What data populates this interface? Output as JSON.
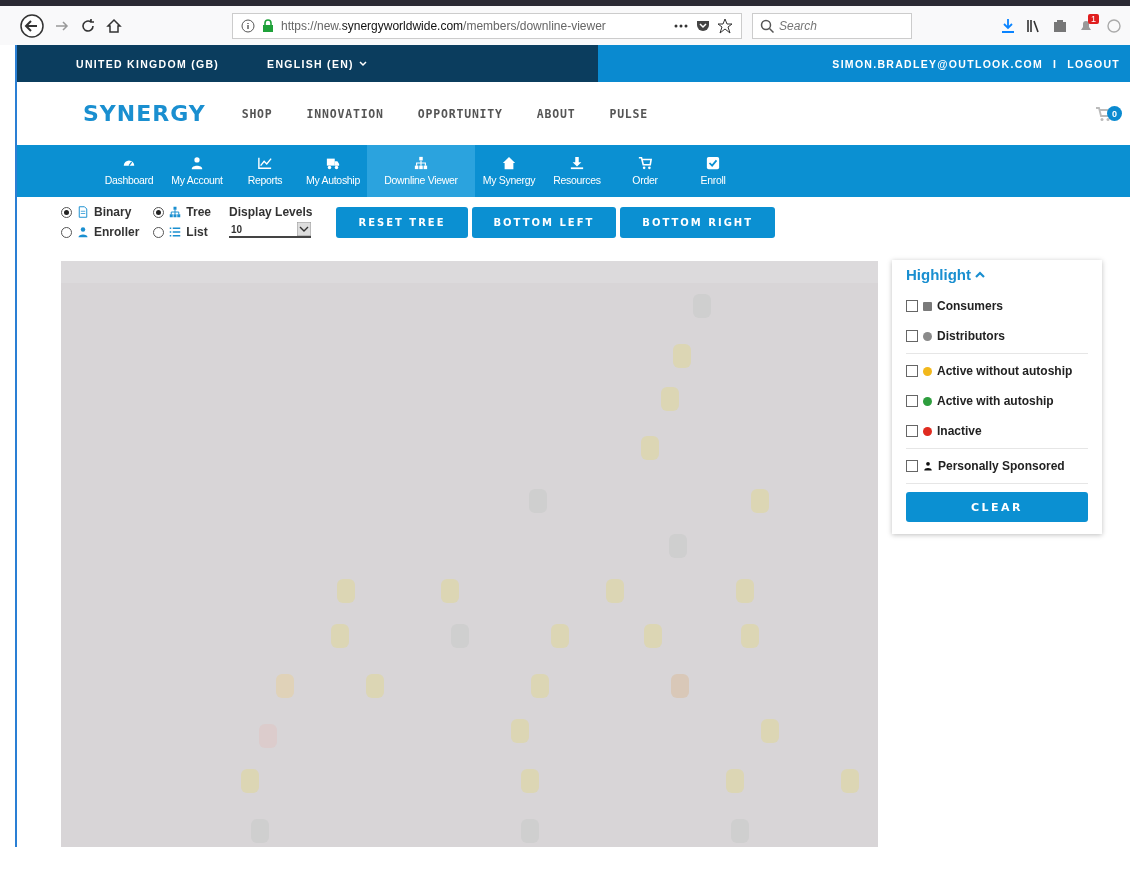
{
  "browser": {
    "url_prefix": "https://new.",
    "url_domain": "synergyworldwide.com",
    "url_path": "/members/downline-viewer",
    "search_placeholder": "Search",
    "notification_count": "1"
  },
  "topbar": {
    "country": "UNITED KINGDOM (GB)",
    "language": "ENGLISH (EN)",
    "email": "SIMON.BRADLEY@OUTLOOK.COM",
    "separator": "I",
    "logout": "LOGOUT"
  },
  "header": {
    "logo": "SYNERGY",
    "menu": [
      "SHOP",
      "INNOVATION",
      "OPPORTUNITY",
      "ABOUT",
      "PULSE"
    ],
    "cart_count": "0"
  },
  "nav": [
    {
      "label": "Dashboard",
      "kind": "gauge",
      "selected": false
    },
    {
      "label": "My Account",
      "kind": "person",
      "selected": false
    },
    {
      "label": "Reports",
      "kind": "chart",
      "selected": false
    },
    {
      "label": "My Autoship",
      "kind": "truck",
      "selected": false
    },
    {
      "label": "Downline Viewer",
      "kind": "sitemap",
      "selected": true
    },
    {
      "label": "My Synergy",
      "kind": "home",
      "selected": false
    },
    {
      "label": "Resources",
      "kind": "download",
      "selected": false
    },
    {
      "label": "Order",
      "kind": "cart",
      "selected": false
    },
    {
      "label": "Enroll",
      "kind": "check",
      "selected": false
    }
  ],
  "controls": {
    "type_options": [
      {
        "label": "Binary",
        "kind": "doc",
        "selected": true
      },
      {
        "label": "Enroller",
        "kind": "person",
        "selected": false
      }
    ],
    "view_options": [
      {
        "label": "Tree",
        "kind": "sitemap",
        "selected": true
      },
      {
        "label": "List",
        "kind": "list",
        "selected": false
      }
    ],
    "display_levels": {
      "label": "Display Levels",
      "value": "10"
    },
    "buttons": [
      "RESET TREE",
      "BOTTOM LEFT",
      "BOTTOM RIGHT"
    ]
  },
  "highlight": {
    "title": "Highlight",
    "expanded": true,
    "groups": [
      [
        {
          "label": "Consumers",
          "kind": "square",
          "color": "#7a7a7a",
          "checked": false
        },
        {
          "label": "Distributors",
          "kind": "dot",
          "color": "#8a8a8a",
          "checked": false
        }
      ],
      [
        {
          "label": "Active without autoship",
          "kind": "dot",
          "color": "#f2b81c",
          "checked": false
        },
        {
          "label": "Active with autoship",
          "kind": "dot",
          "color": "#2e9e3e",
          "checked": false
        },
        {
          "label": "Inactive",
          "kind": "dot",
          "color": "#e02b20",
          "checked": false
        }
      ],
      [
        {
          "label": "Personally Sponsored",
          "kind": "person",
          "checked": false
        }
      ]
    ],
    "clear": "CLEAR"
  }
}
